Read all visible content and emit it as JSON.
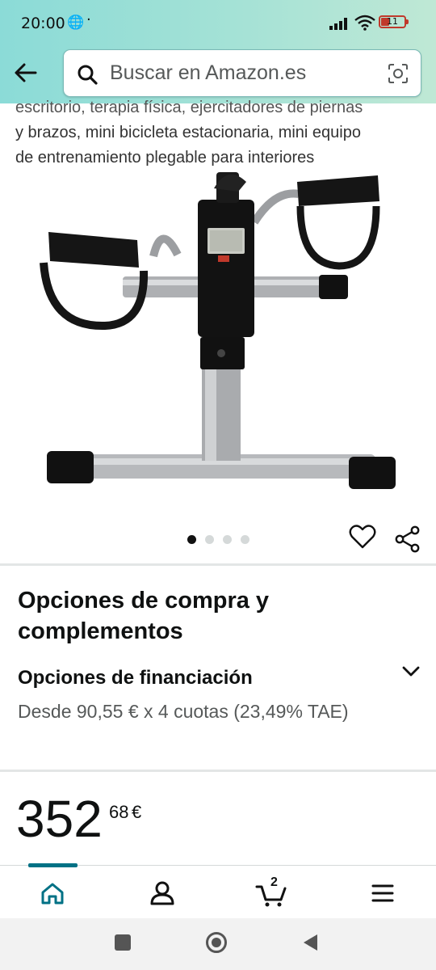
{
  "status_bar": {
    "time": "20:00",
    "battery": "11"
  },
  "search": {
    "placeholder": "Buscar en Amazon.es"
  },
  "product": {
    "title_lines": [
      "escritorio, terapia física, ejercitadores de piernas",
      "y brazos, mini bicicleta estacionaria, mini equipo",
      "de entrenamiento plegable para interiores"
    ],
    "image_count": 4,
    "active_image": 1
  },
  "options": {
    "title": "Opciones de compra y complementos",
    "financing_title": "Opciones de financiación",
    "financing_desc": "Desde 90,55 € x 4 cuotas (23,49% TAE)"
  },
  "price": {
    "whole": "352",
    "fraction": "68",
    "currency": "€"
  },
  "bottom_nav": {
    "items": [
      "home-icon",
      "account-icon",
      "cart-icon",
      "menu-icon"
    ],
    "cart_count": "2",
    "active": "home"
  },
  "colors": {
    "accent": "#007185",
    "header_start": "#8bdbd7",
    "header_end": "#bfe8d5",
    "text_secondary": "#565959"
  }
}
